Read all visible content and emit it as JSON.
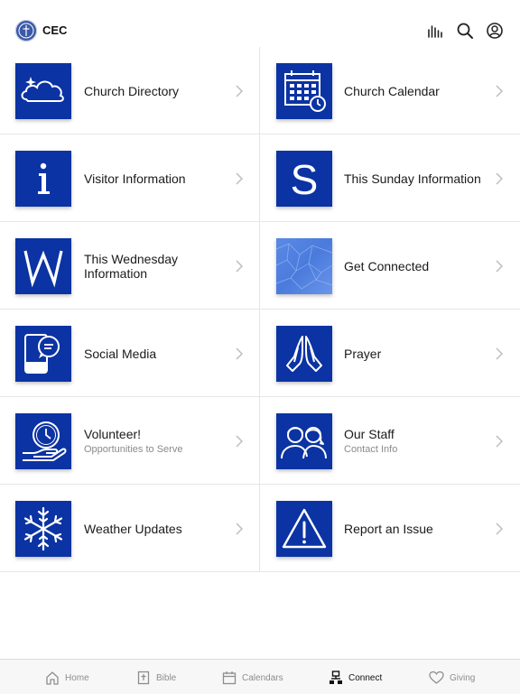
{
  "header": {
    "app_name": "CEC",
    "icons": [
      "broadcast-bars-icon",
      "search-icon",
      "account-icon"
    ]
  },
  "grid": [
    [
      {
        "label": "Church Directory",
        "sublabel": "",
        "icon": "cloud-icon"
      },
      {
        "label": "Church Calendar",
        "sublabel": "",
        "icon": "calendar-clock-icon"
      }
    ],
    [
      {
        "label": "Visitor Information",
        "sublabel": "",
        "icon": "info-icon"
      },
      {
        "label": "This Sunday Information",
        "sublabel": "",
        "icon": "letter-s-icon"
      }
    ],
    [
      {
        "label": "This Wednesday Information",
        "sublabel": "",
        "icon": "letter-w-icon"
      },
      {
        "label": "Get Connected",
        "sublabel": "",
        "icon": "network-pattern-icon"
      }
    ],
    [
      {
        "label": "Social Media",
        "sublabel": "",
        "icon": "chat-phone-icon"
      },
      {
        "label": "Prayer",
        "sublabel": "",
        "icon": "praying-hands-icon"
      }
    ],
    [
      {
        "label": "Volunteer!",
        "sublabel": "Opportunities to Serve",
        "icon": "hand-clock-icon"
      },
      {
        "label": "Our Staff",
        "sublabel": "Contact Info",
        "icon": "people-icon"
      }
    ],
    [
      {
        "label": "Weather Updates",
        "sublabel": "",
        "icon": "snowflake-icon"
      },
      {
        "label": "Report an Issue",
        "sublabel": "",
        "icon": "warning-icon"
      }
    ]
  ],
  "tabs": [
    {
      "label": "Home",
      "icon": "home-icon",
      "active": false
    },
    {
      "label": "Bible",
      "icon": "bible-icon",
      "active": false
    },
    {
      "label": "Calendars",
      "icon": "calendar-icon",
      "active": false
    },
    {
      "label": "Connect",
      "icon": "connect-icon",
      "active": true
    },
    {
      "label": "Giving",
      "icon": "heart-icon",
      "active": false
    }
  ],
  "colors": {
    "tile": "#0b33a3",
    "text": "#1a1a1a",
    "muted": "#8d8d8d",
    "divider": "#e6e6e6"
  }
}
